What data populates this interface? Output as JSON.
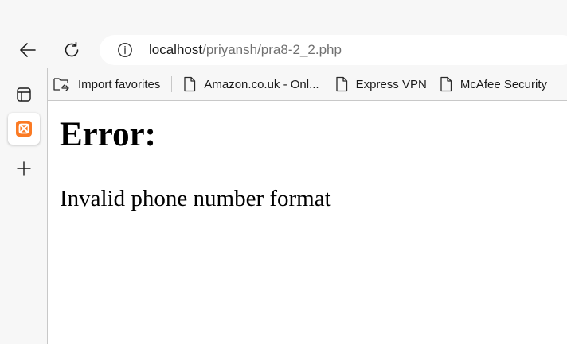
{
  "toolbar": {
    "back_icon": "arrow-left-icon",
    "refresh_icon": "refresh-icon"
  },
  "address_bar": {
    "info_icon": "info-icon",
    "url_host": "localhost",
    "url_path": "/priyansh/pra8-2_2.php"
  },
  "favorites_bar": {
    "items": [
      {
        "label": "Import favorites",
        "icon": "import-favorites-icon"
      },
      {
        "label": "Amazon.co.uk - Onl...",
        "icon": "page-icon"
      },
      {
        "label": "Express VPN",
        "icon": "page-icon"
      },
      {
        "label": "McAfee Security",
        "icon": "page-icon"
      }
    ]
  },
  "sidebar": {
    "items": [
      {
        "name": "tab-actions",
        "icon": "tab-actions-icon"
      },
      {
        "name": "xampp-tab",
        "icon": "xampp-icon",
        "active": true,
        "accent": "#fb7a24"
      },
      {
        "name": "new-tab",
        "icon": "plus-icon"
      }
    ]
  },
  "page": {
    "heading": "Error:",
    "message": "Invalid phone number format"
  }
}
